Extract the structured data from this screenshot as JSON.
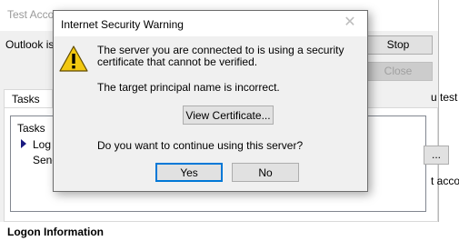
{
  "background_window": {
    "title": "Test Acco",
    "description": "Outlook is",
    "stop_label": "Stop",
    "close_label": "Close",
    "tabs": [
      {
        "label": "Tasks"
      }
    ],
    "tasks_header": "Tasks",
    "task_items": [
      "Log o",
      "Send"
    ],
    "small_button_label": "...",
    "right_text_1": "u test",
    "right_text_2": "t acco",
    "logon_info": "Logon Information"
  },
  "dialog": {
    "title": "Internet Security Warning",
    "close_icon": "close-icon",
    "warning_icon": "warning-icon",
    "warning_icon_color": "#f2c811",
    "message": "The server you are connected to is using a security certificate that cannot be verified.",
    "detail": "The target principal name is incorrect.",
    "view_certificate_label": "View Certificate...",
    "question": "Do you want to continue using this server?",
    "yes_label": "Yes",
    "no_label": "No"
  }
}
